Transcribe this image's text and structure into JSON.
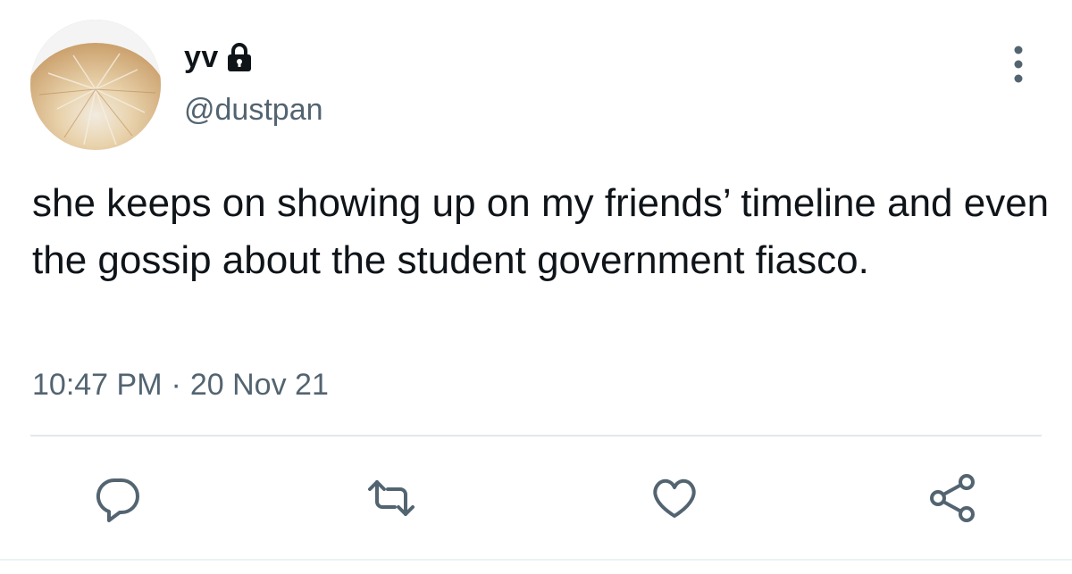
{
  "user": {
    "display_name": "yv",
    "handle": "@dustpan",
    "avatar_icon": "avatar-photo",
    "protected_icon": "lock-icon"
  },
  "tweet": {
    "text": "she keeps on showing up on my friends’ timeline and even the gossip about the student government fiasco.",
    "time": "10:47 PM",
    "separator": "·",
    "date": "20 Nov 21"
  },
  "actions": {
    "reply_icon": "reply-icon",
    "retweet_icon": "retweet-icon",
    "like_icon": "heart-icon",
    "share_icon": "share-icon"
  },
  "menu_icon": "more-vertical-icon",
  "colors": {
    "text_primary": "#0f1419",
    "text_secondary": "#536471",
    "divider": "#e5e8ea"
  }
}
